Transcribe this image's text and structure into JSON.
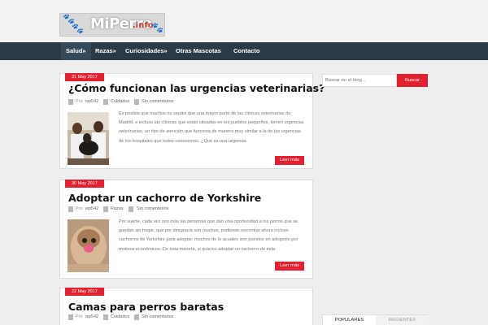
{
  "site": {
    "logo_text": "MiPerro",
    "logo_suffix": ".info"
  },
  "nav": {
    "items": [
      {
        "label": "Salud»"
      },
      {
        "label": "Razas»"
      },
      {
        "label": "Curiosidades»"
      },
      {
        "label": "Otras Mascotas"
      },
      {
        "label": "Contacto"
      }
    ]
  },
  "posts": [
    {
      "date": "31 May 2017",
      "title": "¿Cómo funcionan las urgencias veterinarias?",
      "by": "Por",
      "author": "wp542",
      "category": "Cuidados",
      "comments": "Sin comentarios",
      "excerpt": "Es posible que muchos no sepáis que una mayor parte de las clínicas veterinarias de Madrid, e incluso las clínicas que están situadas en los pueblos pequeños, tienen urgencias veterinarias, un tipo de atención que funciona de manera muy similar a la de las urgencias de los hospitales que todos conocemos. ¿Qué es una urgencia",
      "readmore": "Leer más"
    },
    {
      "date": "30 May 2017",
      "title": "Adoptar un cachorro de Yorkshire",
      "by": "Por",
      "author": "wp542",
      "category": "Razas",
      "comments": "Sin comentarios",
      "excerpt": "Por suerte, cada vez son más las personas que dan una oportunidad a los perros que se quedan sin hogar, que por desgracia son muchos, pudiendo encontrar ahora incluso cachorros de Yorkshire para adoptar, muchos de lo acuales son puestos en adopción por motivos económicos. De esta manera, si quieres adoptar un cachorro de esta",
      "readmore": "Leer más"
    },
    {
      "date": "22 May 2017",
      "title": "Camas para perros baratas",
      "by": "Por",
      "author": "wp542",
      "category": "Cuidados",
      "comments": "Sin comentarios"
    }
  ],
  "sidebar": {
    "search_placeholder": "Buscar en el blog...",
    "search_button": "Buscar",
    "tabs": [
      {
        "label": "POPULARES"
      },
      {
        "label": "RECIENTES"
      }
    ]
  },
  "colors": {
    "accent": "#e2202f",
    "nav_bg": "#2b3a47",
    "page_bg": "#eeeeee"
  }
}
